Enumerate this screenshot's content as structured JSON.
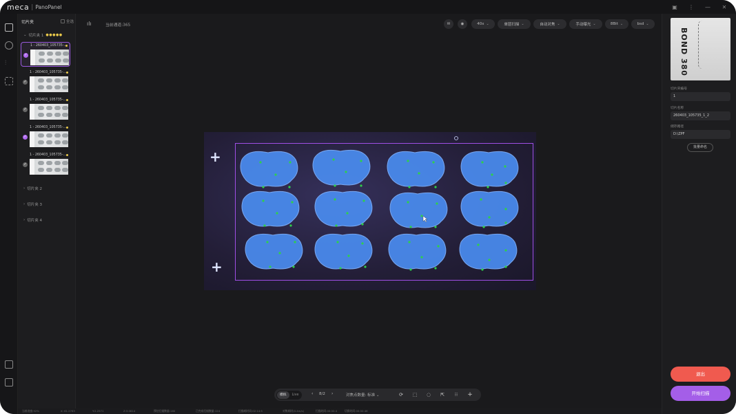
{
  "app": {
    "logo": "meca",
    "product": "PanoPanel"
  },
  "window_controls": [
    "layout-icon",
    "more-icon",
    "minimize-icon",
    "close-icon"
  ],
  "left_panel": {
    "title": "切片夹",
    "select_all": "全选",
    "groups": [
      {
        "label": "切片夹 1",
        "expanded": true
      },
      {
        "label": "切片夹 2",
        "expanded": false
      },
      {
        "label": "切片夹 3",
        "expanded": false
      },
      {
        "label": "切片夹 4",
        "expanded": false
      }
    ],
    "slides": [
      {
        "name": "1 - 260403_105735-...",
        "checked": true,
        "active": true
      },
      {
        "name": "1 - 260403_105735-...",
        "checked": false,
        "active": false
      },
      {
        "name": "1 - 260403_105735-...",
        "checked": false,
        "active": false
      },
      {
        "name": "1 - 260403_105735-...",
        "checked": true,
        "active": false
      },
      {
        "name": "1 - 260403_105735-...",
        "checked": false,
        "active": false
      }
    ]
  },
  "toolbar": {
    "scan_count": "当前通道:365",
    "pills": [
      {
        "label": "40x",
        "icon": "chevron-down-icon"
      },
      {
        "label": "单层扫描",
        "icon": "chevron-down-icon"
      },
      {
        "label": "自动对焦",
        "icon": "chevron-down-icon"
      },
      {
        "label": "手动曝光",
        "icon": "chevron-down-icon"
      },
      {
        "label": "8Bit",
        "icon": "chevron-down-icon"
      },
      {
        "label": "bsd",
        "icon": "chevron-down-icon"
      }
    ]
  },
  "bottom_toolbar": {
    "mode_options": [
      "模拟",
      "Live"
    ],
    "mode_selected": "模拟",
    "page": "8/2",
    "focus_points_label": "对焦点数量: 标准"
  },
  "status_bar": [
    "当前进度:52%",
    "X: 61.2763",
    "Y:2.2571",
    "Z:3.0814",
    "预估扫描数量:160",
    "已完成扫描数量:124",
    "扫描耗时间:02:14:5",
    "对焦耗时(0.4m/s)",
    "扫描时间:00:00:4",
    "切换时间:00:00:46"
  ],
  "right_panel": {
    "label_text": "BOND 380",
    "fields": [
      {
        "label": "切片夹编号",
        "value": "1"
      },
      {
        "label": "切片名称",
        "value": "260403_105735_1_2"
      },
      {
        "label": "储存路径",
        "value": "D:\\ZPF"
      }
    ],
    "rename_button": "批量命名",
    "exit_button": "退出",
    "scan_button": "开始扫描"
  },
  "colors": {
    "accent_purple": "#a45ee8",
    "danger_red": "#f05a4f",
    "selection_purple": "#a04fe6",
    "focus_point_green": "#2fd04a",
    "tissue_blue": "#4a8cf0"
  }
}
